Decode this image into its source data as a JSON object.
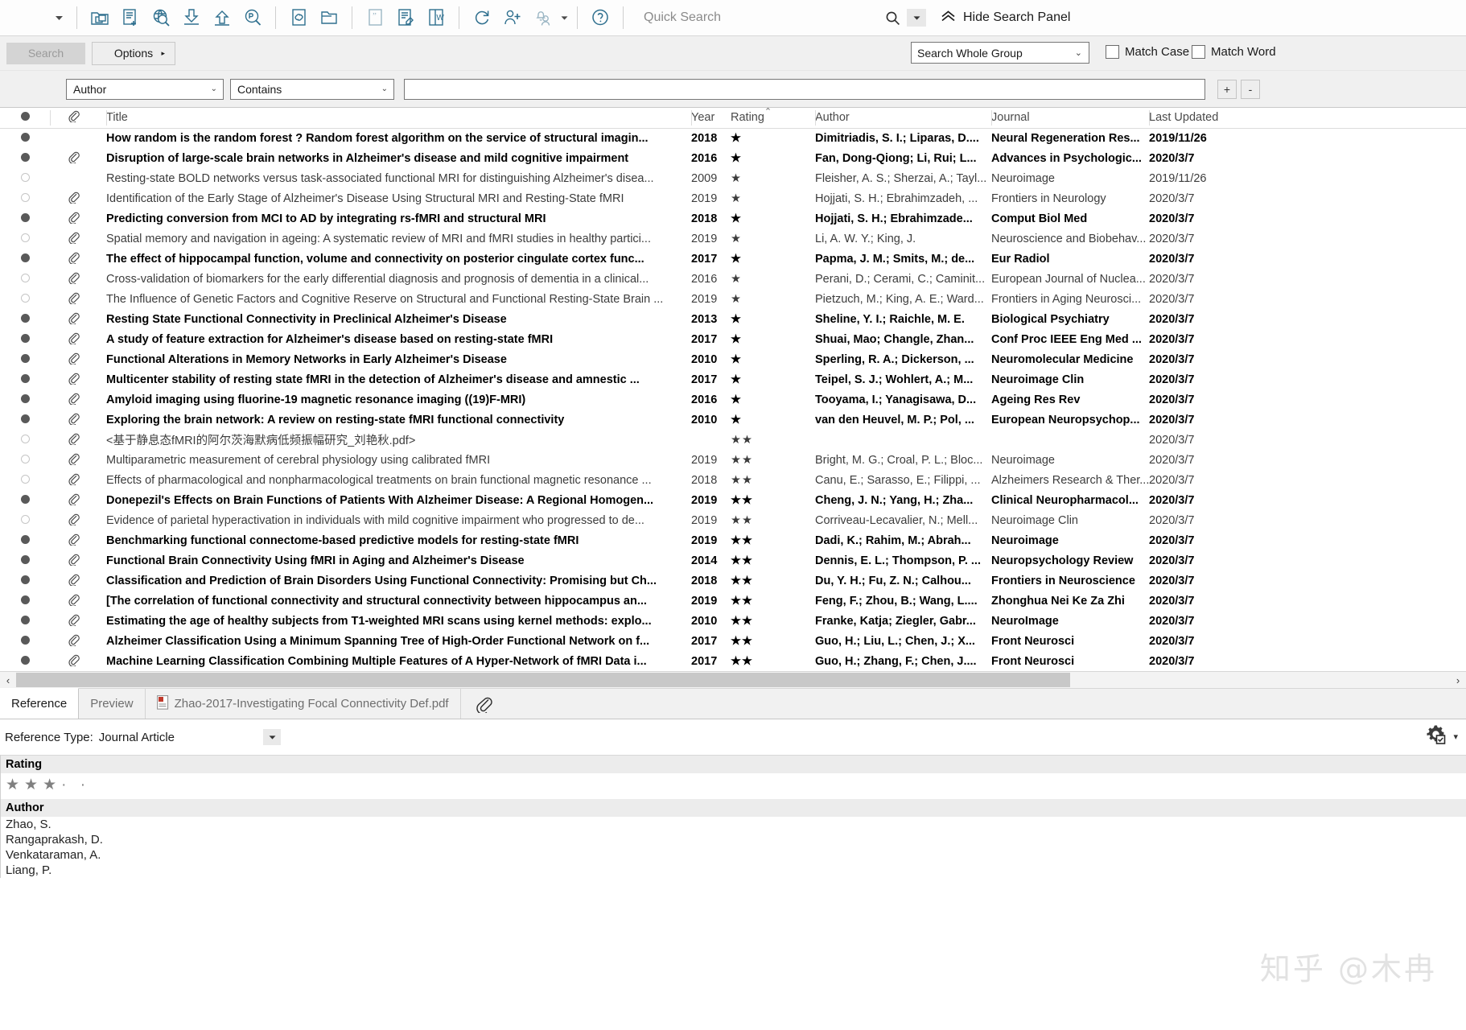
{
  "toolbar": {
    "dropdown_icon": "chevron-down-icon",
    "buttons": [
      {
        "name": "new-reference-group-icon",
        "title": "Copy to Group"
      },
      {
        "name": "new-reference-icon",
        "title": "New Reference"
      },
      {
        "name": "online-search-icon",
        "title": "Online Search"
      },
      {
        "name": "import-icon",
        "title": "Import"
      },
      {
        "name": "export-icon",
        "title": "Export"
      },
      {
        "name": "find-full-text-pdf-icon",
        "title": "Find Full Text"
      },
      {
        "name": "link-icon",
        "title": "Open Link"
      },
      {
        "name": "open-file-icon",
        "title": "Open File"
      },
      {
        "name": "quote-style-icon",
        "title": "Output Style"
      },
      {
        "name": "edit-citation-icon",
        "title": "Edit Citation"
      },
      {
        "name": "word-export-icon",
        "title": "Export to Word"
      },
      {
        "name": "sync-icon",
        "title": "Sync"
      },
      {
        "name": "share-library-icon",
        "title": "Share Library"
      },
      {
        "name": "notifications-icon",
        "title": "Activity Feed"
      },
      {
        "name": "help-icon",
        "title": "Help"
      }
    ],
    "quick_search_placeholder": "Quick Search",
    "search_icon": "magnifier-icon",
    "search_dropdown_icon": "chevron-down-icon",
    "hide_panel_icon": "double-chevron-up-icon",
    "hide_panel_label": "Hide Search Panel"
  },
  "search": {
    "search_button": "Search",
    "options_button": "Options",
    "options_arrow": "▸",
    "scope_value": "Search Whole Group",
    "match_case_label": "Match Case",
    "match_word_label": "Match Word",
    "field_select": "Author",
    "operator_select": "Contains",
    "query_value": "",
    "add_row_button": "+",
    "remove_row_button": "-"
  },
  "table": {
    "headers": {
      "dot": "",
      "clip": "",
      "title": "Title",
      "year": "Year",
      "rating": "Rating",
      "rating_sort": "⌃",
      "author": "Author",
      "journal": "Journal",
      "last_updated": "Last Updated"
    },
    "rows": [
      {
        "read": true,
        "clip": false,
        "bold": true,
        "title": "How random is the random forest ? Random forest algorithm on the service of structural imagin...",
        "year": "2018",
        "rating": "★",
        "author": "Dimitriadis, S. I.; Liparas, D....",
        "journal": "Neural Regeneration Res...",
        "updated": "2019/11/26"
      },
      {
        "read": true,
        "clip": true,
        "bold": true,
        "title": "Disruption of large-scale brain networks in Alzheimer's disease and mild cognitive impairment",
        "year": "2016",
        "rating": "★",
        "author": "Fan, Dong-Qiong; Li, Rui; L...",
        "journal": "Advances in Psychologic...",
        "updated": "2020/3/7"
      },
      {
        "read": false,
        "clip": false,
        "bold": false,
        "title": "Resting-state BOLD networks versus task-associated functional MRI for distinguishing Alzheimer's disea...",
        "year": "2009",
        "rating": "★",
        "author": "Fleisher, A. S.; Sherzai, A.; Tayl...",
        "journal": "Neuroimage",
        "updated": "2019/11/26"
      },
      {
        "read": false,
        "clip": true,
        "bold": false,
        "title": "Identification of the Early Stage of Alzheimer's Disease Using Structural MRI and Resting-State fMRI",
        "year": "2019",
        "rating": "★",
        "author": "Hojjati, S. H.; Ebrahimzadeh, ...",
        "journal": "Frontiers in Neurology",
        "updated": "2020/3/7"
      },
      {
        "read": true,
        "clip": true,
        "bold": true,
        "title": "Predicting conversion from MCI to AD by integrating rs-fMRI and structural MRI",
        "year": "2018",
        "rating": "★",
        "author": "Hojjati, S. H.; Ebrahimzade...",
        "journal": "Comput Biol Med",
        "updated": "2020/3/7"
      },
      {
        "read": false,
        "clip": true,
        "bold": false,
        "title": "Spatial memory and navigation in ageing: A systematic review of MRI and fMRI studies in healthy partici...",
        "year": "2019",
        "rating": "★",
        "author": "Li, A. W. Y.; King, J.",
        "journal": "Neuroscience and Biobehav...",
        "updated": "2020/3/7"
      },
      {
        "read": true,
        "clip": true,
        "bold": true,
        "title": "The effect of hippocampal function, volume and connectivity on posterior cingulate cortex func...",
        "year": "2017",
        "rating": "★",
        "author": "Papma, J. M.; Smits, M.; de...",
        "journal": "Eur Radiol",
        "updated": "2020/3/7"
      },
      {
        "read": false,
        "clip": true,
        "bold": false,
        "title": "Cross-validation of biomarkers for the early differential diagnosis and prognosis of dementia in a clinical...",
        "year": "2016",
        "rating": "★",
        "author": "Perani, D.; Cerami, C.; Caminit...",
        "journal": "European Journal of Nuclea...",
        "updated": "2020/3/7"
      },
      {
        "read": false,
        "clip": true,
        "bold": false,
        "title": "The Influence of Genetic Factors and Cognitive Reserve on Structural and Functional Resting-State Brain ...",
        "year": "2019",
        "rating": "★",
        "author": "Pietzuch, M.; King, A. E.; Ward...",
        "journal": "Frontiers in Aging Neurosci...",
        "updated": "2020/3/7"
      },
      {
        "read": true,
        "clip": true,
        "bold": true,
        "title": "Resting State Functional Connectivity in Preclinical Alzheimer's Disease",
        "year": "2013",
        "rating": "★",
        "author": "Sheline, Y. I.; Raichle, M. E.",
        "journal": "Biological Psychiatry",
        "updated": "2020/3/7"
      },
      {
        "read": true,
        "clip": true,
        "bold": true,
        "title": "A study of feature extraction for Alzheimer's disease based on resting-state fMRI",
        "year": "2017",
        "rating": "★",
        "author": "Shuai, Mao; Changle, Zhan...",
        "journal": "Conf Proc IEEE Eng Med ...",
        "updated": "2020/3/7"
      },
      {
        "read": true,
        "clip": true,
        "bold": true,
        "title": "Functional Alterations in Memory Networks in Early Alzheimer's Disease",
        "year": "2010",
        "rating": "★",
        "author": "Sperling, R. A.; Dickerson, ...",
        "journal": "Neuromolecular Medicine",
        "updated": "2020/3/7"
      },
      {
        "read": true,
        "clip": true,
        "bold": true,
        "title": "Multicenter stability of resting state fMRI in the detection of Alzheimer's disease and amnestic ...",
        "year": "2017",
        "rating": "★",
        "author": "Teipel, S. J.; Wohlert, A.; M...",
        "journal": "Neuroimage Clin",
        "updated": "2020/3/7"
      },
      {
        "read": true,
        "clip": true,
        "bold": true,
        "title": "Amyloid imaging using fluorine-19 magnetic resonance imaging ((19)F-MRI)",
        "year": "2016",
        "rating": "★",
        "author": "Tooyama, I.; Yanagisawa, D...",
        "journal": "Ageing Res Rev",
        "updated": "2020/3/7"
      },
      {
        "read": true,
        "clip": true,
        "bold": true,
        "title": "Exploring the brain network: A review on resting-state fMRI functional connectivity",
        "year": "2010",
        "rating": "★",
        "author": "van den Heuvel, M. P.; Pol, ...",
        "journal": "European Neuropsychop...",
        "updated": "2020/3/7"
      },
      {
        "read": false,
        "clip": true,
        "bold": false,
        "title": "<基于静息态fMRI的阿尔茨海默病低频振幅研究_刘艳秋.pdf>",
        "year": "",
        "rating": "★★",
        "author": "",
        "journal": "",
        "updated": "2020/3/7"
      },
      {
        "read": false,
        "clip": true,
        "bold": false,
        "title": "Multiparametric measurement of cerebral physiology using calibrated fMRI",
        "year": "2019",
        "rating": "★★",
        "author": "Bright, M. G.; Croal, P. L.; Bloc...",
        "journal": "Neuroimage",
        "updated": "2020/3/7"
      },
      {
        "read": false,
        "clip": true,
        "bold": false,
        "title": "Effects of pharmacological and nonpharmacological treatments on brain functional magnetic resonance ...",
        "year": "2018",
        "rating": "★★",
        "author": "Canu, E.; Sarasso, E.; Filippi, ...",
        "journal": "Alzheimers Research & Ther...",
        "updated": "2020/3/7"
      },
      {
        "read": true,
        "clip": true,
        "bold": true,
        "title": "Donepezil's Effects on Brain Functions of Patients With Alzheimer Disease: A Regional Homogen...",
        "year": "2019",
        "rating": "★★",
        "author": "Cheng, J. N.; Yang, H.; Zha...",
        "journal": "Clinical Neuropharmacol...",
        "updated": "2020/3/7"
      },
      {
        "read": false,
        "clip": true,
        "bold": false,
        "title": "Evidence of parietal hyperactivation in individuals with mild cognitive impairment who progressed to de...",
        "year": "2019",
        "rating": "★★",
        "author": "Corriveau-Lecavalier, N.; Mell...",
        "journal": "Neuroimage Clin",
        "updated": "2020/3/7"
      },
      {
        "read": true,
        "clip": true,
        "bold": true,
        "title": "Benchmarking functional connectome-based predictive models for resting-state fMRI",
        "year": "2019",
        "rating": "★★",
        "author": "Dadi, K.; Rahim, M.; Abrah...",
        "journal": "Neuroimage",
        "updated": "2020/3/7"
      },
      {
        "read": true,
        "clip": true,
        "bold": true,
        "title": "Functional Brain Connectivity Using fMRI in Aging and Alzheimer's Disease",
        "year": "2014",
        "rating": "★★",
        "author": "Dennis, E. L.; Thompson, P. ...",
        "journal": "Neuropsychology Review",
        "updated": "2020/3/7"
      },
      {
        "read": true,
        "clip": true,
        "bold": true,
        "title": "Classification and Prediction of Brain Disorders Using Functional Connectivity: Promising but Ch...",
        "year": "2018",
        "rating": "★★",
        "author": "Du, Y. H.; Fu, Z. N.; Calhou...",
        "journal": "Frontiers in Neuroscience",
        "updated": "2020/3/7"
      },
      {
        "read": true,
        "clip": true,
        "bold": true,
        "title": "[The correlation of functional connectivity and structural connectivity between hippocampus an...",
        "year": "2019",
        "rating": "★★",
        "author": "Feng, F.; Zhou, B.; Wang, L....",
        "journal": "Zhonghua Nei Ke Za Zhi",
        "updated": "2020/3/7"
      },
      {
        "read": true,
        "clip": true,
        "bold": true,
        "title": "Estimating the age of healthy subjects from T1-weighted MRI scans using kernel methods: explo...",
        "year": "2010",
        "rating": "★★",
        "author": "Franke, Katja; Ziegler, Gabr...",
        "journal": "NeuroImage",
        "updated": "2020/3/7"
      },
      {
        "read": true,
        "clip": true,
        "bold": true,
        "title": "Alzheimer Classification Using a Minimum Spanning Tree of High-Order Functional Network on f...",
        "year": "2017",
        "rating": "★★",
        "author": "Guo, H.; Liu, L.; Chen, J.; X...",
        "journal": "Front Neurosci",
        "updated": "2020/3/7"
      },
      {
        "read": true,
        "clip": true,
        "bold": true,
        "title": "Machine Learning Classification Combining Multiple Features of A Hyper-Network of fMRI Data i...",
        "year": "2017",
        "rating": "★★",
        "author": "Guo, H.; Zhang, F.; Chen, J....",
        "journal": "Front Neurosci",
        "updated": "2020/3/7"
      }
    ]
  },
  "hscroll": {
    "left_arrow": "‹",
    "right_arrow": "›"
  },
  "bottom_panel": {
    "tab_reference": "Reference",
    "tab_preview": "Preview",
    "tab_pdf": "Zhao-2017-Investigating Focal Connectivity Def.pdf",
    "pdf_icon": "pdf-file-icon",
    "attachment_icon": "paperclip-icon",
    "reference_type_label": "Reference Type:",
    "reference_type_value": "Journal Article",
    "gear_icon": "gear-settings-icon",
    "gear_caret": "▾",
    "rating_label": "Rating",
    "rating_filled": "★★★",
    "rating_empty": "· ·",
    "author_label": "Author",
    "authors": [
      "Zhao, S.",
      "Rangaprakash, D.",
      "Venkataraman, A.",
      "Liang, P."
    ]
  },
  "watermark": "知乎 @木冉",
  "colors": {
    "icon_blue": "#1f5f7a",
    "star_gray": "#808080",
    "accent_bg": "#f0f0f0"
  }
}
